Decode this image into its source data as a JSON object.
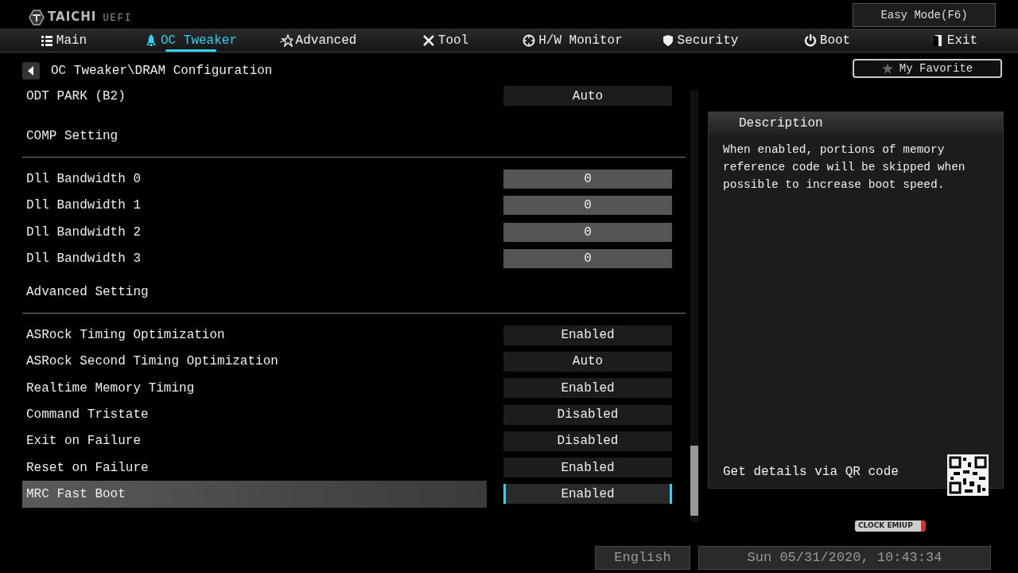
{
  "logo": {
    "brand": "TAICHI",
    "suffix": "UEFI"
  },
  "easy_mode_button": "Easy Mode(F6)",
  "tabs": [
    {
      "label": "Main",
      "selected": false
    },
    {
      "label": "OC Tweaker",
      "selected": true
    },
    {
      "label": "Advanced",
      "selected": false
    },
    {
      "label": "Tool",
      "selected": false
    },
    {
      "label": "H/W Monitor",
      "selected": false
    },
    {
      "label": "Security",
      "selected": false
    },
    {
      "label": "Boot",
      "selected": false
    },
    {
      "label": "Exit",
      "selected": false
    }
  ],
  "breadcrumb": "OC Tweaker\\DRAM Configuration",
  "favorite_button": "My Favorite",
  "settings": [
    {
      "kind": "option",
      "label": "ODT PARK (B2)",
      "value": "Auto",
      "selected": false
    },
    {
      "kind": "heading",
      "label": "COMP Setting"
    },
    {
      "kind": "number",
      "label": "Dll Bandwidth 0",
      "value": "0",
      "selected": false
    },
    {
      "kind": "number",
      "label": "Dll Bandwidth 1",
      "value": "0",
      "selected": false
    },
    {
      "kind": "number",
      "label": "Dll Bandwidth 2",
      "value": "0",
      "selected": false
    },
    {
      "kind": "number",
      "label": "Dll Bandwidth 3",
      "value": "0",
      "selected": false
    },
    {
      "kind": "heading",
      "label": "Advanced Setting"
    },
    {
      "kind": "option",
      "label": "ASRock Timing Optimization",
      "value": "Enabled",
      "selected": false
    },
    {
      "kind": "option",
      "label": "ASRock Second Timing Optimization",
      "value": "Auto",
      "selected": false
    },
    {
      "kind": "option",
      "label": "Realtime Memory Timing",
      "value": "Enabled",
      "selected": false
    },
    {
      "kind": "option",
      "label": "Command Tristate",
      "value": "Disabled",
      "selected": false
    },
    {
      "kind": "option",
      "label": "Exit on Failure",
      "value": "Disabled",
      "selected": false
    },
    {
      "kind": "option",
      "label": "Reset on Failure",
      "value": "Enabled",
      "selected": false
    },
    {
      "kind": "option",
      "label": "MRC Fast Boot",
      "value": "Enabled",
      "selected": true
    }
  ],
  "description": {
    "title": "Description",
    "text": "When enabled, portions of memory reference code will be skipped when possible to increase boot speed.",
    "qr_hint": "Get details via QR code"
  },
  "badge_logo": "CLOCK EMIUP",
  "status_bar": {
    "language": "English",
    "datetime": "Sun 05/31/2020, 10:43:34"
  }
}
